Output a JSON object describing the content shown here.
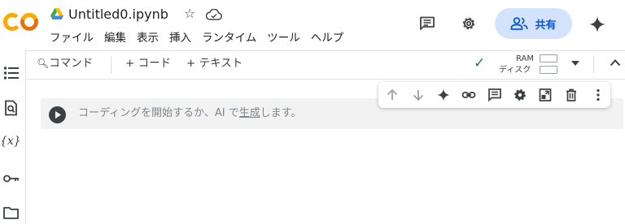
{
  "header": {
    "logo_text": "CO",
    "notebook_title": "Untitled0.ipynb",
    "menu": [
      "ファイル",
      "編集",
      "表示",
      "挿入",
      "ランタイム",
      "ツール",
      "ヘルプ"
    ],
    "share_label": "共有",
    "icons": {
      "drive": "google-drive-icon",
      "star": "star-outline-icon",
      "cloud": "cloud-saved-icon",
      "comment": "comment-icon",
      "settings": "gear-icon",
      "share": "people-icon",
      "gemini": "gemini-sparkle-icon"
    }
  },
  "toolbar": {
    "command_label": "コマンド",
    "add_code_label": "+ コード",
    "add_text_label": "+ テキスト",
    "ram_label": "RAM",
    "disk_label": "ディスク"
  },
  "cell": {
    "placeholder_before": "コーディングを開始するか、AI で",
    "placeholder_link": "生成",
    "placeholder_after": "します。"
  },
  "colors": {
    "accent": "#0b57d0",
    "share_bg": "#d3e3fd",
    "logo_orange": "#f9ab00",
    "logo_orange_dark": "#e8710a",
    "check_green": "#188038"
  }
}
